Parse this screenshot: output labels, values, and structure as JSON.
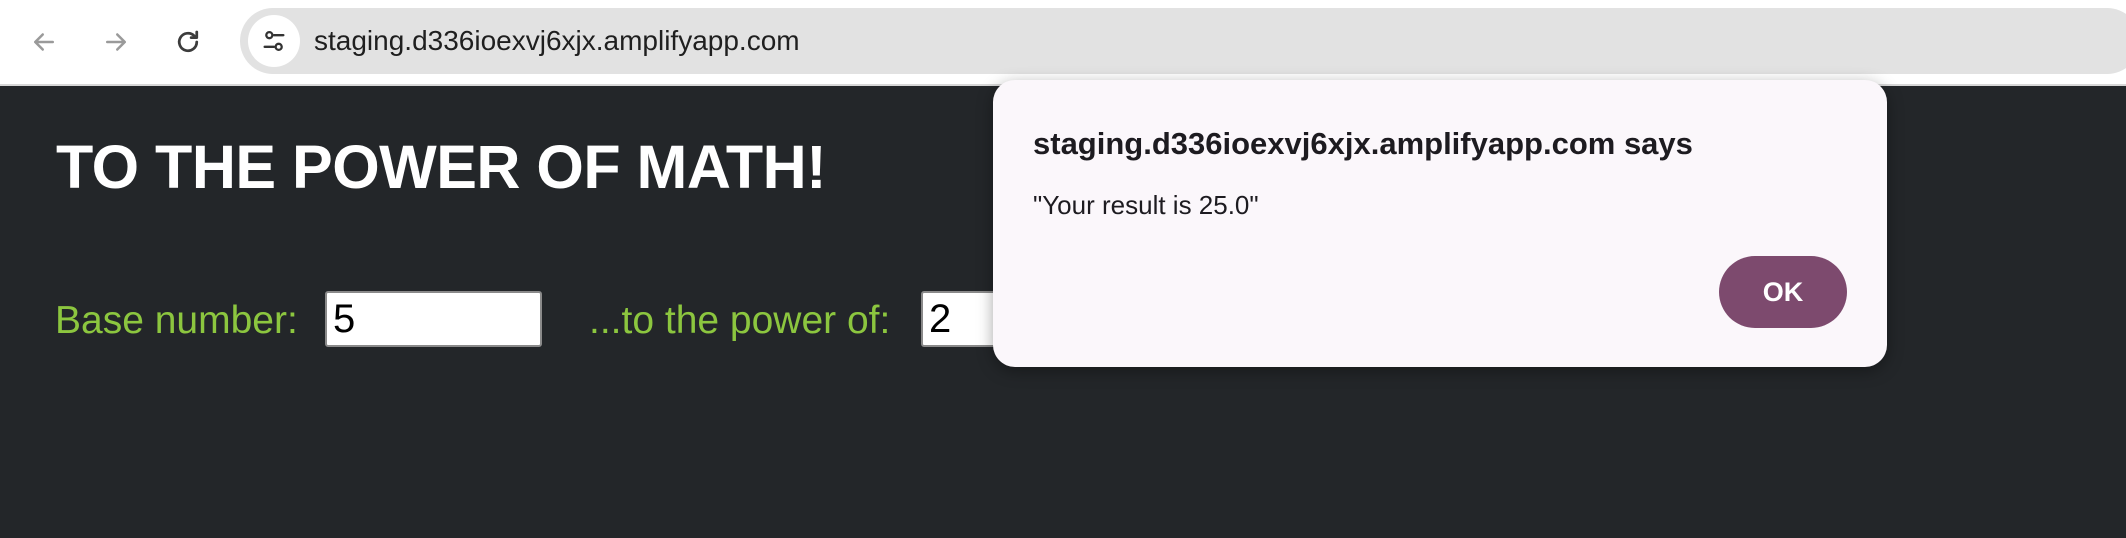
{
  "browser": {
    "url": "staging.d336ioexvj6xjx.amplifyapp.com",
    "icons": {
      "back": "arrow-left-icon",
      "forward": "arrow-right-icon",
      "reload": "reload-icon",
      "site_info": "tune-icon"
    }
  },
  "page": {
    "title": "TO THE POWER OF MATH!",
    "base_label": "Base number:",
    "base_value": "5",
    "power_label": "...to the power of:",
    "power_value": "2"
  },
  "dialog": {
    "title": "staging.d336ioexvj6xjx.amplifyapp.com says",
    "message": "\"Your result is 25.0\"",
    "ok_label": "OK"
  },
  "colors": {
    "page_background": "#232629",
    "label_green": "#8cc63f",
    "ok_button": "#7d4a6e",
    "dialog_background": "#fbf7fb"
  }
}
